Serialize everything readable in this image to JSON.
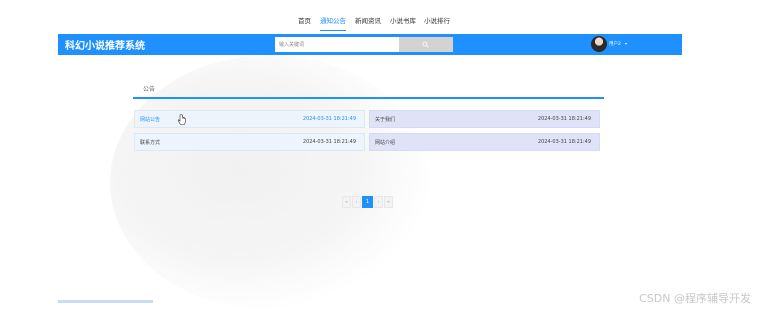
{
  "nav": {
    "items": [
      {
        "label": "首页",
        "active": false
      },
      {
        "label": "通知公告",
        "active": true
      },
      {
        "label": "新闻资讯",
        "active": false
      },
      {
        "label": "小说书库",
        "active": false
      },
      {
        "label": "小说排行",
        "active": false
      }
    ]
  },
  "header": {
    "brand": "科幻小说推荐系统",
    "search_placeholder": "输入关键词",
    "search_icon": "search-icon",
    "username": "用户2",
    "caret": "▾",
    "accent_color": "#1e90ff"
  },
  "notice": {
    "section_title": "公告",
    "items": [
      {
        "title": "网站公告",
        "date": "2024-03-31 18:21:49"
      },
      {
        "title": "关于我们",
        "date": "2024-03-31 18:21:49"
      },
      {
        "title": "联系方式",
        "date": "2024-03-31 18:21:49"
      },
      {
        "title": "网站介绍",
        "date": "2024-03-31 18:21:49"
      }
    ]
  },
  "pagination": {
    "first": "«",
    "prev": "‹",
    "current": "1",
    "next": "›",
    "last": "»"
  },
  "watermark": "CSDN @程序辅导开发"
}
